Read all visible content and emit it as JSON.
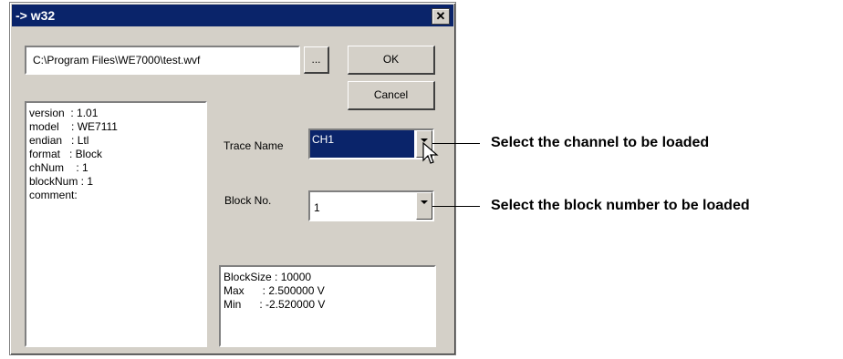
{
  "window": {
    "title": "-> w32",
    "close_glyph": "✕"
  },
  "file": {
    "path": "C:\\Program Files\\WE7000\\test.wvf",
    "browse_label": "..."
  },
  "buttons": {
    "ok": "OK",
    "cancel": "Cancel"
  },
  "info": {
    "lines": [
      "version  : 1.01",
      "model    : WE7111",
      "endian   : Ltl",
      "format   : Block",
      "chNum    : 1",
      "blockNum : 1",
      "",
      "comment:"
    ]
  },
  "trace": {
    "label": "Trace Name",
    "value": "CH1"
  },
  "block": {
    "label": "Block No.",
    "value": "1"
  },
  "details": {
    "lines": [
      "BlockSize : 10000",
      "Max      : 2.500000 V",
      "Min      : -2.520000 V"
    ]
  },
  "callouts": {
    "channel": "Select the channel to be loaded",
    "block": "Select the block number to be loaded"
  },
  "colors": {
    "titlebar": "#0a246a",
    "face": "#d4d0c8",
    "selection": "#0a246a"
  },
  "icons": {
    "cursor": "arrow-cursor-icon",
    "dropdown": "chevron-down-icon",
    "close": "close-icon"
  }
}
